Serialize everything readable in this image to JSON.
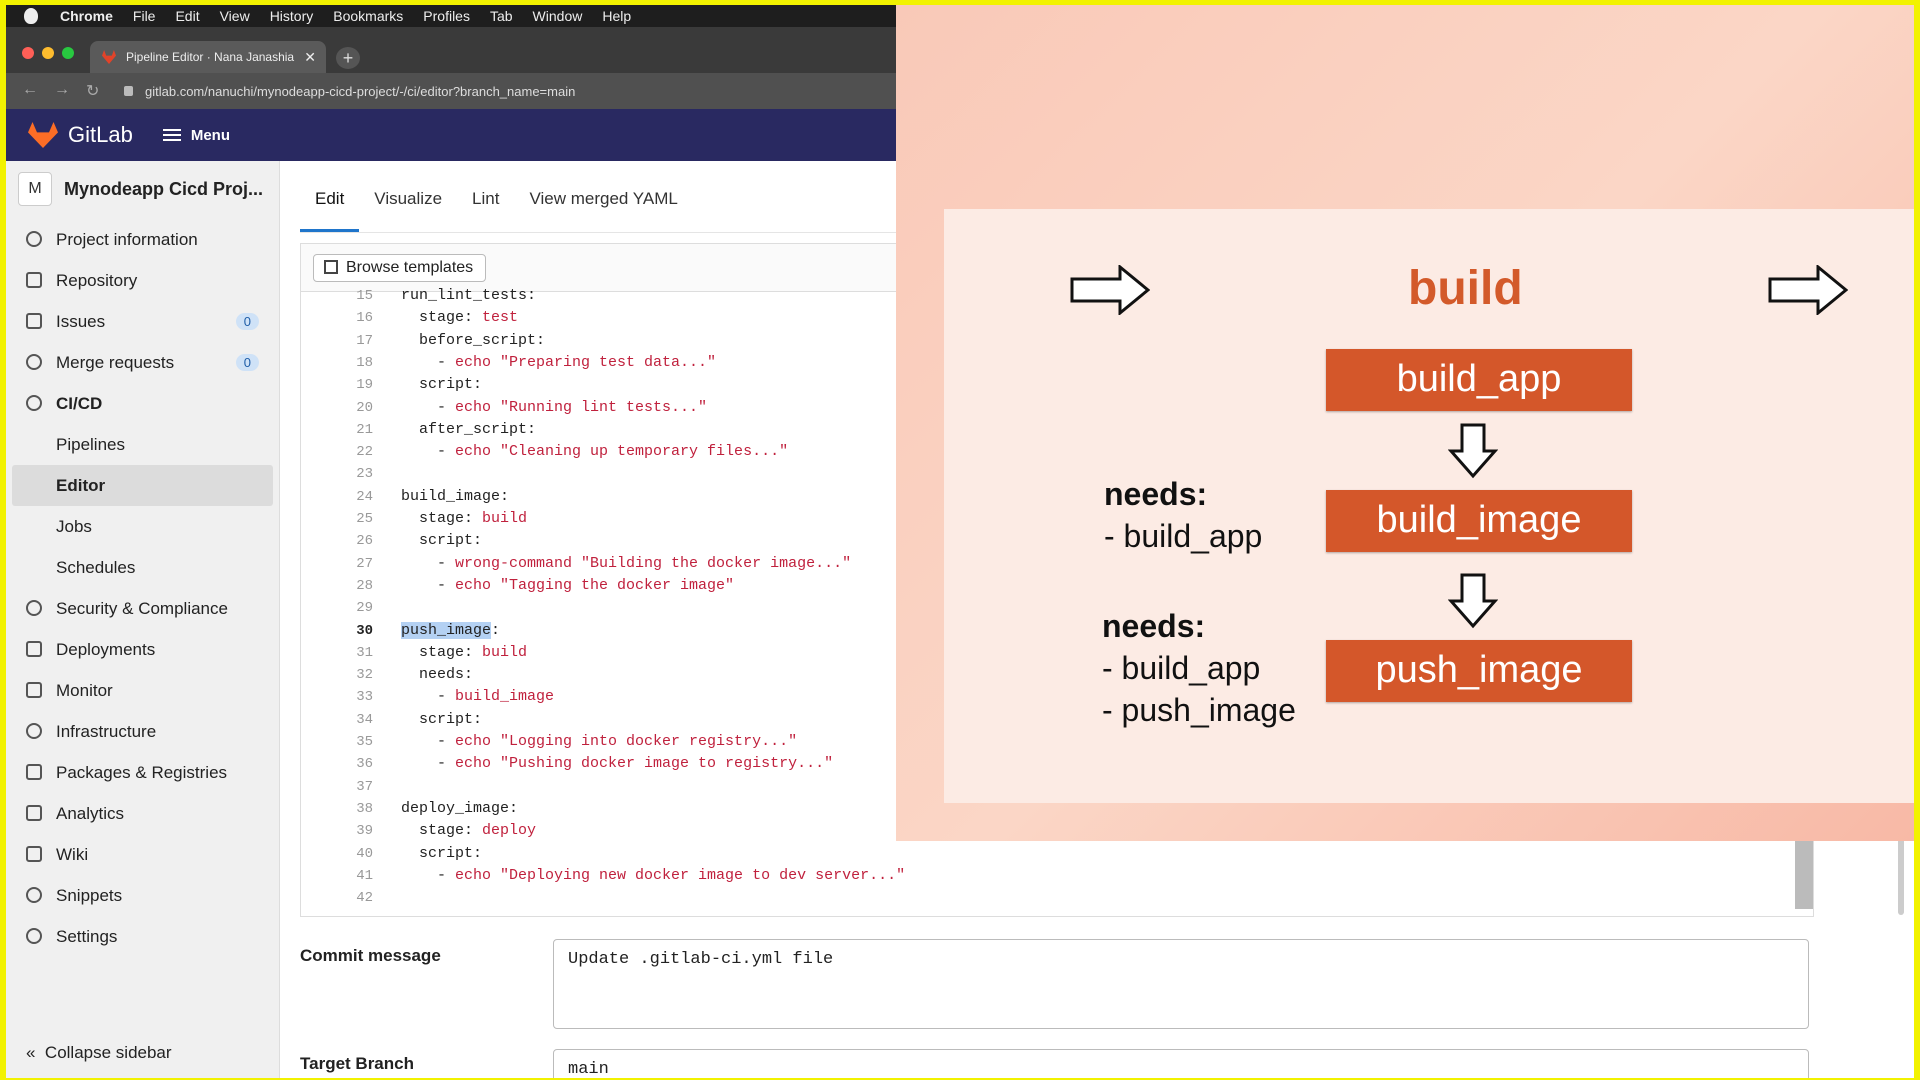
{
  "menubar": {
    "app": "Chrome",
    "items": [
      "File",
      "Edit",
      "View",
      "History",
      "Bookmarks",
      "Profiles",
      "Tab",
      "Window",
      "Help"
    ]
  },
  "browser": {
    "tab_title": "Pipeline Editor · Nana Janashia",
    "url": "gitlab.com/nanuchi/mynodeapp-cicd-project/-/ci/editor?branch_name=main"
  },
  "gitlab": {
    "brand": "GitLab",
    "menu": "Menu"
  },
  "sidebar": {
    "avatar": "M",
    "project": "Mynodeapp Cicd Proj...",
    "items": [
      {
        "label": "Project information"
      },
      {
        "label": "Repository"
      },
      {
        "label": "Issues",
        "badge": "0"
      },
      {
        "label": "Merge requests",
        "badge": "0"
      },
      {
        "label": "CI/CD"
      },
      {
        "label": "Pipelines"
      },
      {
        "label": "Editor"
      },
      {
        "label": "Jobs"
      },
      {
        "label": "Schedules"
      },
      {
        "label": "Security & Compliance"
      },
      {
        "label": "Deployments"
      },
      {
        "label": "Monitor"
      },
      {
        "label": "Infrastructure"
      },
      {
        "label": "Packages & Registries"
      },
      {
        "label": "Analytics"
      },
      {
        "label": "Wiki"
      },
      {
        "label": "Snippets"
      },
      {
        "label": "Settings"
      }
    ],
    "collapse": "Collapse sidebar"
  },
  "editor": {
    "tabs": [
      "Edit",
      "Visualize",
      "Lint",
      "View merged YAML"
    ],
    "browse_templates": "Browse templates",
    "lines": [
      {
        "n": "15",
        "text": "run_lint_tests:"
      },
      {
        "n": "16",
        "text": "  stage: test"
      },
      {
        "n": "17",
        "text": "  before_script:"
      },
      {
        "n": "18",
        "text": "    - echo \"Preparing test data...\""
      },
      {
        "n": "19",
        "text": "  script:"
      },
      {
        "n": "20",
        "text": "    - echo \"Running lint tests...\""
      },
      {
        "n": "21",
        "text": "  after_script:"
      },
      {
        "n": "22",
        "text": "    - echo \"Cleaning up temporary files...\""
      },
      {
        "n": "23",
        "text": ""
      },
      {
        "n": "24",
        "text": "build_image:"
      },
      {
        "n": "25",
        "text": "  stage: build"
      },
      {
        "n": "26",
        "text": "  script:"
      },
      {
        "n": "27",
        "text": "    - wrong-command \"Building the docker image...\""
      },
      {
        "n": "28",
        "text": "    - echo \"Tagging the docker image\""
      },
      {
        "n": "29",
        "text": ""
      },
      {
        "n": "30",
        "text": "push_image:"
      },
      {
        "n": "31",
        "text": "  stage: build"
      },
      {
        "n": "32",
        "text": "  needs:"
      },
      {
        "n": "33",
        "text": "    - build_image"
      },
      {
        "n": "34",
        "text": "  script:"
      },
      {
        "n": "35",
        "text": "    - echo \"Logging into docker registry...\""
      },
      {
        "n": "36",
        "text": "    - echo \"Pushing docker image to registry...\""
      },
      {
        "n": "37",
        "text": ""
      },
      {
        "n": "38",
        "text": "deploy_image:"
      },
      {
        "n": "39",
        "text": "  stage: deploy"
      },
      {
        "n": "40",
        "text": "  script:"
      },
      {
        "n": "41",
        "text": "    - echo \"Deploying new docker image to dev server...\""
      },
      {
        "n": "42",
        "text": ""
      }
    ],
    "current_line": "30"
  },
  "commit": {
    "label": "Commit message",
    "value": "Update .gitlab-ci.yml file"
  },
  "target": {
    "label": "Target Branch",
    "value": "main"
  },
  "slide": {
    "stage": "build",
    "jobs": [
      "build_app",
      "build_image",
      "push_image"
    ],
    "needs1_title": "needs:",
    "needs1_items": [
      "- build_app"
    ],
    "needs2_title": "needs:",
    "needs2_items": [
      "- build_app",
      "- push_image"
    ]
  },
  "colors": {
    "gitlab_header": "#292961",
    "accent": "#d4572a",
    "border": "#f2f200"
  }
}
